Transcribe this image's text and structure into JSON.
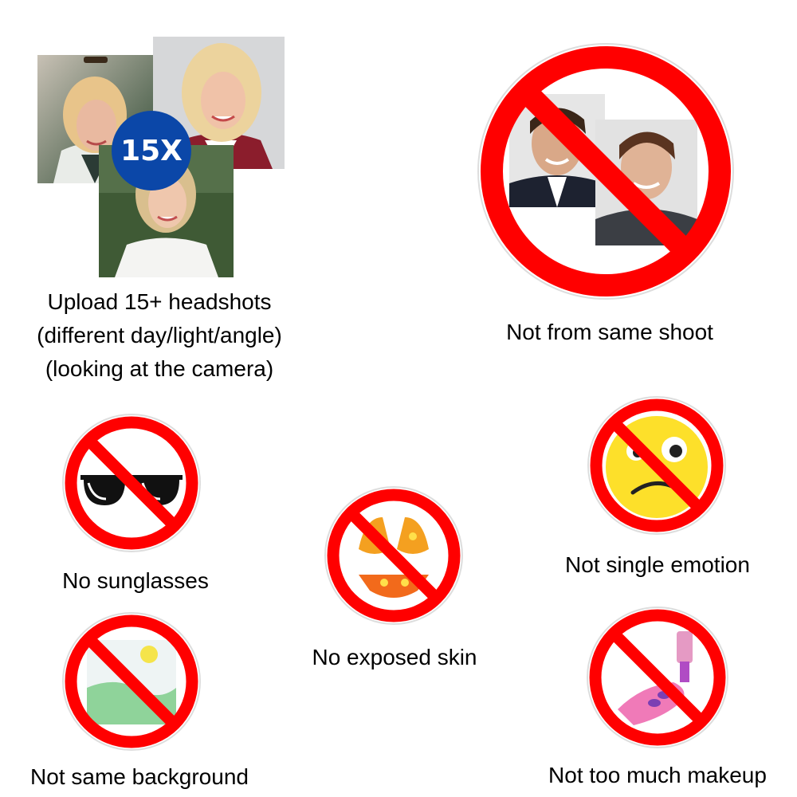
{
  "upload": {
    "badge": "15X",
    "line1": "Upload 15+ headshots",
    "line2": "(different day/light/angle)",
    "line3": "(looking at the camera)"
  },
  "rules": {
    "same_shoot": "Not from same shoot",
    "sunglasses": "No sunglasses",
    "exposed_skin": "No exposed skin",
    "single_emotion": "Not single emotion",
    "same_background": "Not same background",
    "makeup": "Not too much makeup"
  },
  "colors": {
    "prohibition_red": "#ff0000",
    "badge_blue": "#0b47a8"
  },
  "icons": {
    "same_shoot": "two-men-photos",
    "sunglasses": "sunglasses",
    "exposed_skin": "bikini",
    "single_emotion": "confused-face",
    "same_background": "landscape-picture",
    "makeup": "nail-polish"
  }
}
